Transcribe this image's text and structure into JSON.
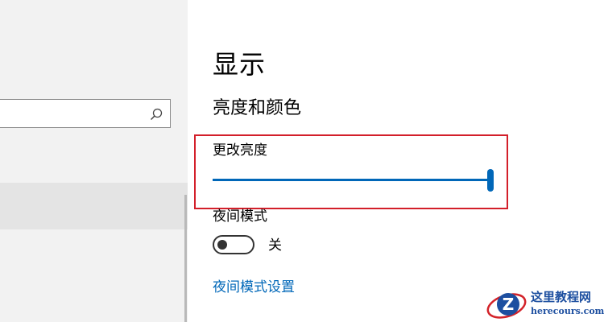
{
  "search": {
    "value": "",
    "placeholder": "",
    "icon": "search-icon"
  },
  "page": {
    "title": "显示",
    "section_title": "亮度和颜色"
  },
  "brightness": {
    "label": "更改亮度",
    "value": 1.0,
    "accent": "#0067b8"
  },
  "night_light": {
    "label": "夜间模式",
    "toggle_on": false,
    "state_text": "关",
    "settings_link": "夜间模式设置"
  },
  "highlight": {
    "color": "#d31f2a"
  },
  "watermark": {
    "title": "这里教程网",
    "subtitle": "herecours.com"
  }
}
